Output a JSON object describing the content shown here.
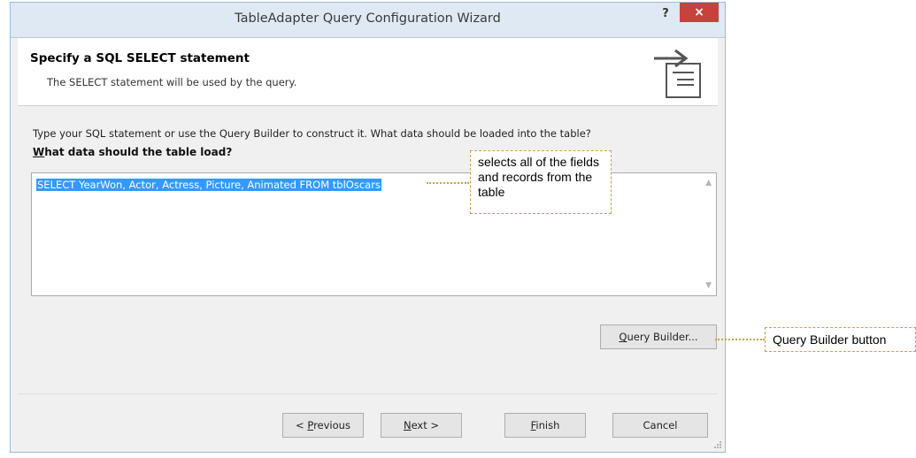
{
  "window": {
    "title": "TableAdapter Query Configuration Wizard",
    "help_label": "?",
    "close_label": "×"
  },
  "header": {
    "title": "Specify a SQL SELECT statement",
    "subtitle": "The SELECT statement will be used by the query."
  },
  "instruction": "Type your SQL statement or use the Query Builder to construct it. What data should be loaded into the table?",
  "field_label": {
    "mnemonic": "W",
    "rest": "hat data should the table load?"
  },
  "sql_text": "SELECT YearWon, Actor, Actress, Picture, Animated FROM tblOscars",
  "query_builder": {
    "mnemonic": "Q",
    "rest": "uery Builder..."
  },
  "buttons": {
    "previous": {
      "prefix": "< ",
      "mnemonic": "P",
      "rest": "revious"
    },
    "next": {
      "mnemonic": "N",
      "rest": "ext >"
    },
    "finish": {
      "mnemonic": "F",
      "rest": "inish"
    },
    "cancel": "Cancel"
  },
  "callouts": {
    "sql": "selects all of the fields and records from the table",
    "query_builder": "Query Builder button"
  },
  "colors": {
    "selection": "#3399ff",
    "close_button": "#c7423c",
    "callout_border": "#c9a23a",
    "titlebar": "#dfe9f3"
  },
  "icons": [
    "query-arrow-icon",
    "scroll-up-icon",
    "scroll-down-icon",
    "resize-grip-icon"
  ]
}
